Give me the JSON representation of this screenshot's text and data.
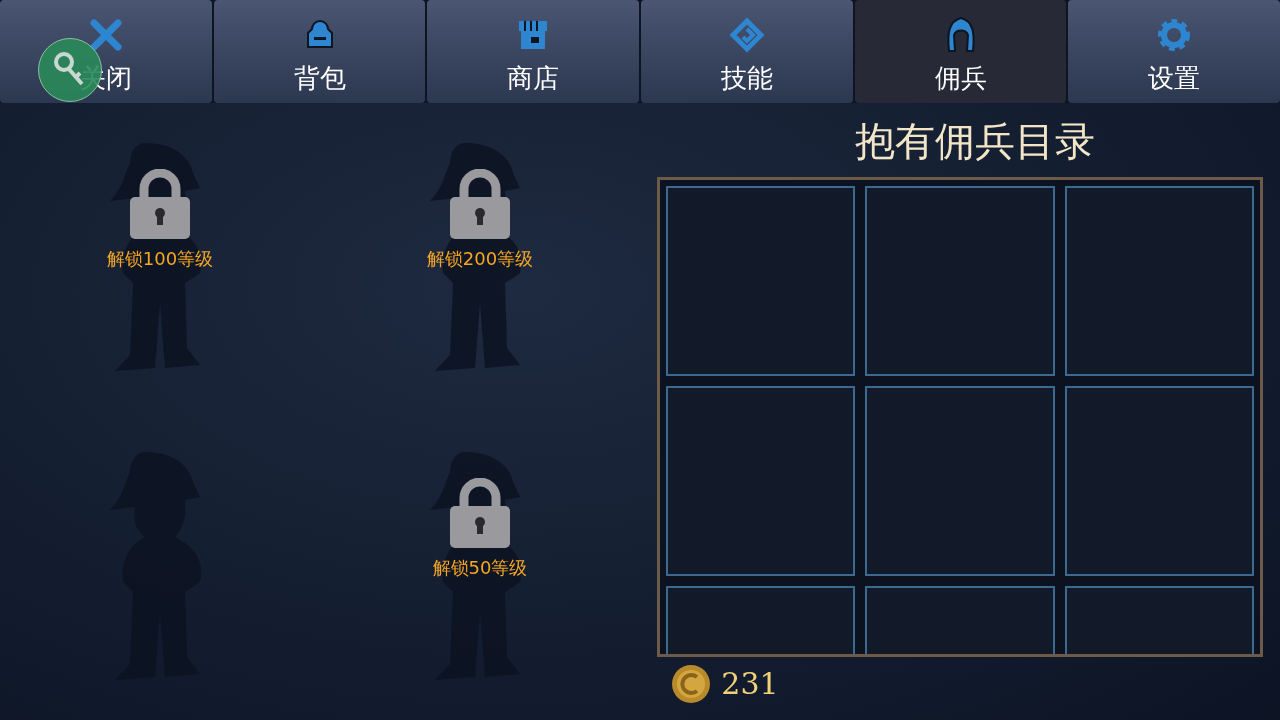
{
  "tabs": [
    {
      "label": "关闭",
      "kind": "close",
      "selected": false
    },
    {
      "label": "背包",
      "kind": "backpack",
      "selected": false
    },
    {
      "label": "商店",
      "kind": "shop",
      "selected": false
    },
    {
      "label": "技能",
      "kind": "skill",
      "selected": false
    },
    {
      "label": "佣兵",
      "kind": "mercenary",
      "selected": true
    },
    {
      "label": "设置",
      "kind": "settings",
      "selected": false
    }
  ],
  "mercenary_slots": [
    {
      "locked": true,
      "label": "解锁100等级"
    },
    {
      "locked": true,
      "label": "解锁200等级"
    },
    {
      "locked": false
    },
    {
      "locked": true,
      "label": "解锁50等级"
    }
  ],
  "roster": {
    "title": "抱有佣兵目录"
  },
  "coins": "231"
}
